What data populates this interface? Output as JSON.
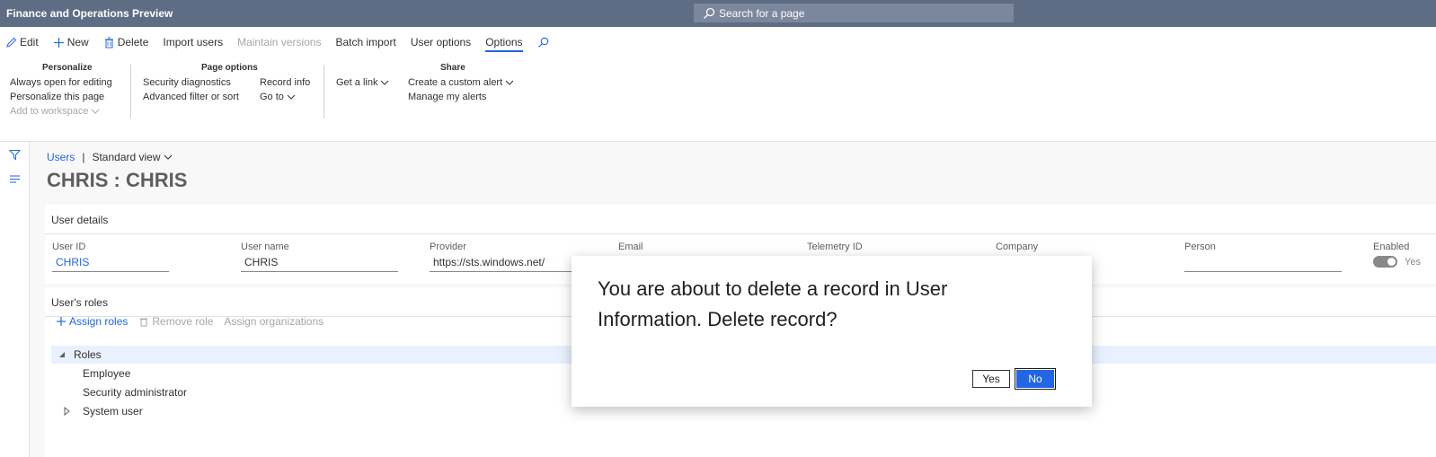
{
  "header": {
    "app_title": "Finance and Operations Preview",
    "search_placeholder": "Search for a page"
  },
  "action_pane": {
    "buttons": [
      {
        "label": "Edit",
        "icon": "pencil-icon"
      },
      {
        "label": "New",
        "icon": "plus-icon"
      },
      {
        "label": "Delete",
        "icon": "trash-icon"
      },
      {
        "label": "Import users"
      },
      {
        "label": "Maintain versions",
        "disabled": true
      },
      {
        "label": "Batch import"
      },
      {
        "label": "User options"
      },
      {
        "label": "Options",
        "active": true
      }
    ],
    "groups": {
      "personalize": {
        "title": "Personalize",
        "items": [
          "Always open for editing",
          "Personalize this page",
          "Add to workspace"
        ]
      },
      "page_options": {
        "title": "Page options",
        "items": [
          "Security diagnostics",
          "Advanced filter or sort",
          "Record info",
          "Go to"
        ]
      },
      "share": {
        "title": "Share",
        "items": [
          "Get a link",
          "Create a custom alert",
          "Manage my alerts"
        ]
      }
    }
  },
  "breadcrumb": {
    "link": "Users",
    "separator": "|",
    "view": "Standard view"
  },
  "page_title": "CHRIS : CHRIS",
  "user_details": {
    "title": "User details",
    "fields": {
      "user_id": {
        "label": "User ID",
        "value": "CHRIS"
      },
      "user_name": {
        "label": "User name",
        "value": "CHRIS"
      },
      "provider": {
        "label": "Provider",
        "value": "https://sts.windows.net/"
      },
      "email": {
        "label": "Email",
        "value": ""
      },
      "telemetry_id": {
        "label": "Telemetry ID",
        "value": ""
      },
      "company": {
        "label": "Company",
        "value": ""
      },
      "person": {
        "label": "Person",
        "value": ""
      },
      "enabled": {
        "label": "Enabled",
        "value": "Yes"
      }
    }
  },
  "user_roles": {
    "title": "User's roles",
    "actions": [
      "Assign roles",
      "Remove role",
      "Assign organizations"
    ],
    "tree": [
      "Roles",
      "Employee",
      "Security administrator",
      "System user"
    ]
  },
  "dialog": {
    "message": "You are about to delete a record in User Information. Delete record?",
    "yes": "Yes",
    "no": "No"
  },
  "colors": {
    "topbar": "#5e6c84",
    "accent": "#2266e3"
  }
}
